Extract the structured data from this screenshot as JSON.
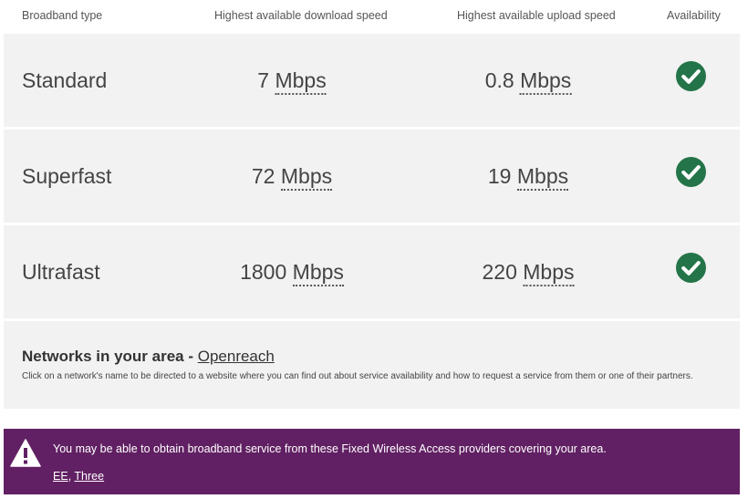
{
  "header": {
    "type": "Broadband type",
    "download": "Highest available download speed",
    "upload": "Highest available upload speed",
    "availability": "Availability"
  },
  "rows": [
    {
      "type": "Standard",
      "download_value": "7",
      "download_unit": "Mbps",
      "upload_value": "0.8",
      "upload_unit": "Mbps",
      "available_icon": "check-circle-icon"
    },
    {
      "type": "Superfast",
      "download_value": "72",
      "download_unit": "Mbps",
      "upload_value": "19",
      "upload_unit": "Mbps",
      "available_icon": "check-circle-icon"
    },
    {
      "type": "Ultrafast",
      "download_value": "1800",
      "download_unit": "Mbps",
      "upload_value": "220",
      "upload_unit": "Mbps",
      "available_icon": "check-circle-icon"
    }
  ],
  "networks": {
    "title": "Networks in your area",
    "separator": " - ",
    "link": "Openreach",
    "description": "Click on a network's name to be directed to a website where you can find out about service availability and how to request a service from them or one of their partners."
  },
  "banner": {
    "icon": "warning-icon",
    "message": "You may be able to obtain broadband service from these Fixed Wireless Access providers covering your area.",
    "link_1": "EE",
    "separator": ", ",
    "link_2": "Three"
  },
  "colors": {
    "row_bg": "#f2f2f2",
    "check_green": "#24744a",
    "banner_purple": "#612063"
  }
}
